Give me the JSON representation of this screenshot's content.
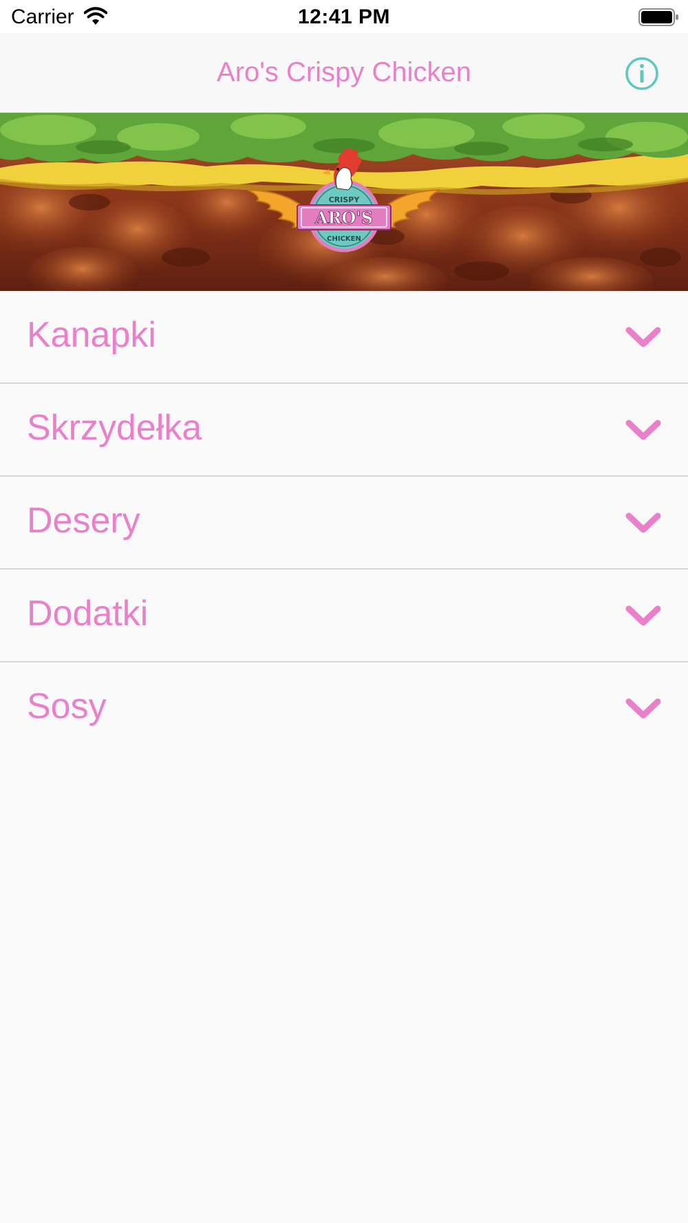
{
  "colors": {
    "accent_pink": "#ea80c9",
    "info_teal": "#5ec8bd",
    "background": "#f9f9f9"
  },
  "status_bar": {
    "carrier": "Carrier",
    "time": "12:41 PM",
    "wifi_icon": "wifi-icon",
    "battery_icon": "battery-icon"
  },
  "nav": {
    "title": "Aro's Crispy Chicken",
    "info_icon": "info-circle-icon"
  },
  "hero": {
    "logo": {
      "top_text": "CRISPY",
      "main_text": "ARO'S",
      "bottom_text": "CHICKEN"
    }
  },
  "menu": {
    "items": [
      {
        "label": "Kanapki",
        "icon": "chevron-down-icon"
      },
      {
        "label": "Skrzydełka",
        "icon": "chevron-down-icon"
      },
      {
        "label": "Desery",
        "icon": "chevron-down-icon"
      },
      {
        "label": "Dodatki",
        "icon": "chevron-down-icon"
      },
      {
        "label": "Sosy",
        "icon": "chevron-down-icon"
      }
    ]
  }
}
